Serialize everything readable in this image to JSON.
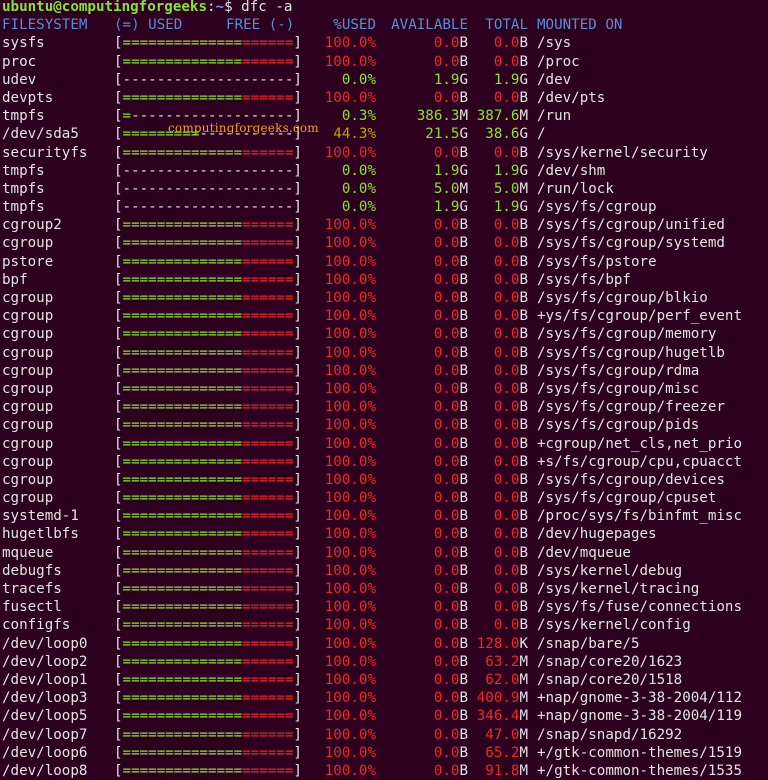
{
  "prompt": {
    "user_host": "ubuntu@computingforgeeks",
    "separator": ":",
    "path": "~",
    "symbol": "$",
    "command": " dfc -a"
  },
  "header": {
    "filesystem": "FILESYSTEM",
    "used": "(=) USED",
    "free": "FREE (-)",
    "pct_used": "%USED",
    "available": "AVAILABLE",
    "total": "TOTAL",
    "mounted_on": "MOUNTED ON"
  },
  "watermark": "computingforgeeks.com",
  "colors": {
    "background": "#2c001e",
    "red": "#ef2929",
    "green": "#8ae234",
    "yellow": "#c4a000",
    "header": "#5c8cd6",
    "text": "#e4e4e4"
  },
  "rows": [
    {
      "fs": "sysfs",
      "bar": "full",
      "pct": "100.0%",
      "avail": "0.0B",
      "total": "0.0B",
      "mount": "/sys",
      "level": "full"
    },
    {
      "fs": "proc",
      "bar": "full",
      "pct": "100.0%",
      "avail": "0.0B",
      "total": "0.0B",
      "mount": "/proc",
      "level": "full"
    },
    {
      "fs": "udev",
      "bar": "empty",
      "pct": "0.0%",
      "avail": "1.9G",
      "total": "1.9G",
      "mount": "/dev",
      "level": "empty"
    },
    {
      "fs": "devpts",
      "bar": "full",
      "pct": "100.0%",
      "avail": "0.0B",
      "total": "0.0B",
      "mount": "/dev/pts",
      "level": "full"
    },
    {
      "fs": "tmpfs",
      "bar": "one",
      "pct": "0.3%",
      "avail": "386.3M",
      "total": "387.6M",
      "mount": "/run",
      "level": "low"
    },
    {
      "fs": "/dev/sda5",
      "bar": "nine",
      "pct": "44.3%",
      "avail": "21.5G",
      "total": "38.6G",
      "mount": "/",
      "level": "mid"
    },
    {
      "fs": "securityfs",
      "bar": "full",
      "pct": "100.0%",
      "avail": "0.0B",
      "total": "0.0B",
      "mount": "/sys/kernel/security",
      "level": "full"
    },
    {
      "fs": "tmpfs",
      "bar": "empty",
      "pct": "0.0%",
      "avail": "1.9G",
      "total": "1.9G",
      "mount": "/dev/shm",
      "level": "empty"
    },
    {
      "fs": "tmpfs",
      "bar": "empty",
      "pct": "0.0%",
      "avail": "5.0M",
      "total": "5.0M",
      "mount": "/run/lock",
      "level": "empty"
    },
    {
      "fs": "tmpfs",
      "bar": "empty",
      "pct": "0.0%",
      "avail": "1.9G",
      "total": "1.9G",
      "mount": "/sys/fs/cgroup",
      "level": "empty"
    },
    {
      "fs": "cgroup2",
      "bar": "full",
      "pct": "100.0%",
      "avail": "0.0B",
      "total": "0.0B",
      "mount": "/sys/fs/cgroup/unified",
      "level": "full"
    },
    {
      "fs": "cgroup",
      "bar": "full",
      "pct": "100.0%",
      "avail": "0.0B",
      "total": "0.0B",
      "mount": "/sys/fs/cgroup/systemd",
      "level": "full"
    },
    {
      "fs": "pstore",
      "bar": "full",
      "pct": "100.0%",
      "avail": "0.0B",
      "total": "0.0B",
      "mount": "/sys/fs/pstore",
      "level": "full"
    },
    {
      "fs": "bpf",
      "bar": "full",
      "pct": "100.0%",
      "avail": "0.0B",
      "total": "0.0B",
      "mount": "/sys/fs/bpf",
      "level": "full"
    },
    {
      "fs": "cgroup",
      "bar": "full",
      "pct": "100.0%",
      "avail": "0.0B",
      "total": "0.0B",
      "mount": "/sys/fs/cgroup/blkio",
      "level": "full"
    },
    {
      "fs": "cgroup",
      "bar": "full",
      "pct": "100.0%",
      "avail": "0.0B",
      "total": "0.0B",
      "mount": "+ys/fs/cgroup/perf_event",
      "level": "full"
    },
    {
      "fs": "cgroup",
      "bar": "full",
      "pct": "100.0%",
      "avail": "0.0B",
      "total": "0.0B",
      "mount": "/sys/fs/cgroup/memory",
      "level": "full"
    },
    {
      "fs": "cgroup",
      "bar": "full",
      "pct": "100.0%",
      "avail": "0.0B",
      "total": "0.0B",
      "mount": "/sys/fs/cgroup/hugetlb",
      "level": "full"
    },
    {
      "fs": "cgroup",
      "bar": "full",
      "pct": "100.0%",
      "avail": "0.0B",
      "total": "0.0B",
      "mount": "/sys/fs/cgroup/rdma",
      "level": "full"
    },
    {
      "fs": "cgroup",
      "bar": "full",
      "pct": "100.0%",
      "avail": "0.0B",
      "total": "0.0B",
      "mount": "/sys/fs/cgroup/misc",
      "level": "full"
    },
    {
      "fs": "cgroup",
      "bar": "full",
      "pct": "100.0%",
      "avail": "0.0B",
      "total": "0.0B",
      "mount": "/sys/fs/cgroup/freezer",
      "level": "full"
    },
    {
      "fs": "cgroup",
      "bar": "full",
      "pct": "100.0%",
      "avail": "0.0B",
      "total": "0.0B",
      "mount": "/sys/fs/cgroup/pids",
      "level": "full"
    },
    {
      "fs": "cgroup",
      "bar": "full",
      "pct": "100.0%",
      "avail": "0.0B",
      "total": "0.0B",
      "mount": "+cgroup/net_cls,net_prio",
      "level": "full"
    },
    {
      "fs": "cgroup",
      "bar": "full",
      "pct": "100.0%",
      "avail": "0.0B",
      "total": "0.0B",
      "mount": "+s/fs/cgroup/cpu,cpuacct",
      "level": "full"
    },
    {
      "fs": "cgroup",
      "bar": "full",
      "pct": "100.0%",
      "avail": "0.0B",
      "total": "0.0B",
      "mount": "/sys/fs/cgroup/devices",
      "level": "full"
    },
    {
      "fs": "cgroup",
      "bar": "full",
      "pct": "100.0%",
      "avail": "0.0B",
      "total": "0.0B",
      "mount": "/sys/fs/cgroup/cpuset",
      "level": "full"
    },
    {
      "fs": "systemd-1",
      "bar": "full",
      "pct": "100.0%",
      "avail": "0.0B",
      "total": "0.0B",
      "mount": "/proc/sys/fs/binfmt_misc",
      "level": "full"
    },
    {
      "fs": "hugetlbfs",
      "bar": "full",
      "pct": "100.0%",
      "avail": "0.0B",
      "total": "0.0B",
      "mount": "/dev/hugepages",
      "level": "full"
    },
    {
      "fs": "mqueue",
      "bar": "full",
      "pct": "100.0%",
      "avail": "0.0B",
      "total": "0.0B",
      "mount": "/dev/mqueue",
      "level": "full"
    },
    {
      "fs": "debugfs",
      "bar": "full",
      "pct": "100.0%",
      "avail": "0.0B",
      "total": "0.0B",
      "mount": "/sys/kernel/debug",
      "level": "full"
    },
    {
      "fs": "tracefs",
      "bar": "full",
      "pct": "100.0%",
      "avail": "0.0B",
      "total": "0.0B",
      "mount": "/sys/kernel/tracing",
      "level": "full"
    },
    {
      "fs": "fusectl",
      "bar": "full",
      "pct": "100.0%",
      "avail": "0.0B",
      "total": "0.0B",
      "mount": "/sys/fs/fuse/connections",
      "level": "full"
    },
    {
      "fs": "configfs",
      "bar": "full",
      "pct": "100.0%",
      "avail": "0.0B",
      "total": "0.0B",
      "mount": "/sys/kernel/config",
      "level": "full"
    },
    {
      "fs": "/dev/loop0",
      "bar": "full",
      "pct": "100.0%",
      "avail": "0.0B",
      "total": "128.0K",
      "mount": "/snap/bare/5",
      "level": "full"
    },
    {
      "fs": "/dev/loop2",
      "bar": "full",
      "pct": "100.0%",
      "avail": "0.0B",
      "total": "63.2M",
      "mount": "/snap/core20/1623",
      "level": "full"
    },
    {
      "fs": "/dev/loop1",
      "bar": "full",
      "pct": "100.0%",
      "avail": "0.0B",
      "total": "62.0M",
      "mount": "/snap/core20/1518",
      "level": "full"
    },
    {
      "fs": "/dev/loop3",
      "bar": "full",
      "pct": "100.0%",
      "avail": "0.0B",
      "total": "400.9M",
      "mount": "+nap/gnome-3-38-2004/112",
      "level": "full"
    },
    {
      "fs": "/dev/loop5",
      "bar": "full",
      "pct": "100.0%",
      "avail": "0.0B",
      "total": "346.4M",
      "mount": "+nap/gnome-3-38-2004/119",
      "level": "full"
    },
    {
      "fs": "/dev/loop7",
      "bar": "full",
      "pct": "100.0%",
      "avail": "0.0B",
      "total": "47.0M",
      "mount": "/snap/snapd/16292",
      "level": "full"
    },
    {
      "fs": "/dev/loop6",
      "bar": "full",
      "pct": "100.0%",
      "avail": "0.0B",
      "total": "65.2M",
      "mount": "+/gtk-common-themes/1519",
      "level": "full"
    },
    {
      "fs": "/dev/loop8",
      "bar": "full",
      "pct": "100.0%",
      "avail": "0.0B",
      "total": "91.8M",
      "mount": "+/gtk-common-themes/1535",
      "level": "full"
    }
  ]
}
